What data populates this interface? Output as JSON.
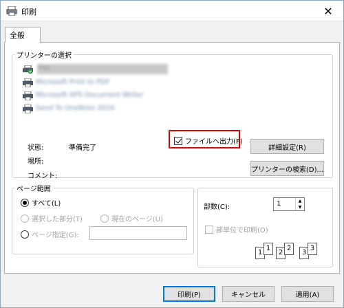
{
  "window": {
    "title": "印刷",
    "close_glyph": "✕"
  },
  "tab": {
    "label": "全般"
  },
  "printer_select": {
    "legend": "プリンターの選択",
    "printers": [
      {
        "name": "Fax"
      },
      {
        "name": "Microsoft Print to PDF"
      },
      {
        "name": "Microsoft XPS Document Writer"
      },
      {
        "name": "Send To OneNote 2016"
      }
    ],
    "status_label": "状態:",
    "status_value": "準備完了",
    "location_label": "場所:",
    "comment_label": "コメント:",
    "print_to_file_label": "ファイルへ出力(F)",
    "print_to_file_checked": true,
    "preferences_button": "詳細設定(R)",
    "find_printer_button": "プリンターの検索(D)..."
  },
  "page_range": {
    "legend": "ページ範囲",
    "all_label": "すべて(L)",
    "selection_label": "選択した部分(T)",
    "current_page_label": "現在のページ(U)",
    "pages_label": "ページ指定(G):",
    "pages_value": ""
  },
  "copies": {
    "count_label": "部数(C):",
    "count_value": "1",
    "collate_label": "部単位で印刷(O)",
    "collate_checked": false,
    "collate_pages": [
      "1",
      "1",
      "2",
      "2",
      "3",
      "3"
    ]
  },
  "footer": {
    "print_button": "印刷(P)",
    "cancel_button": "キャンセル",
    "apply_button": "適用(A)"
  },
  "colors": {
    "highlight": "#e00000",
    "accent": "#0078d7"
  }
}
